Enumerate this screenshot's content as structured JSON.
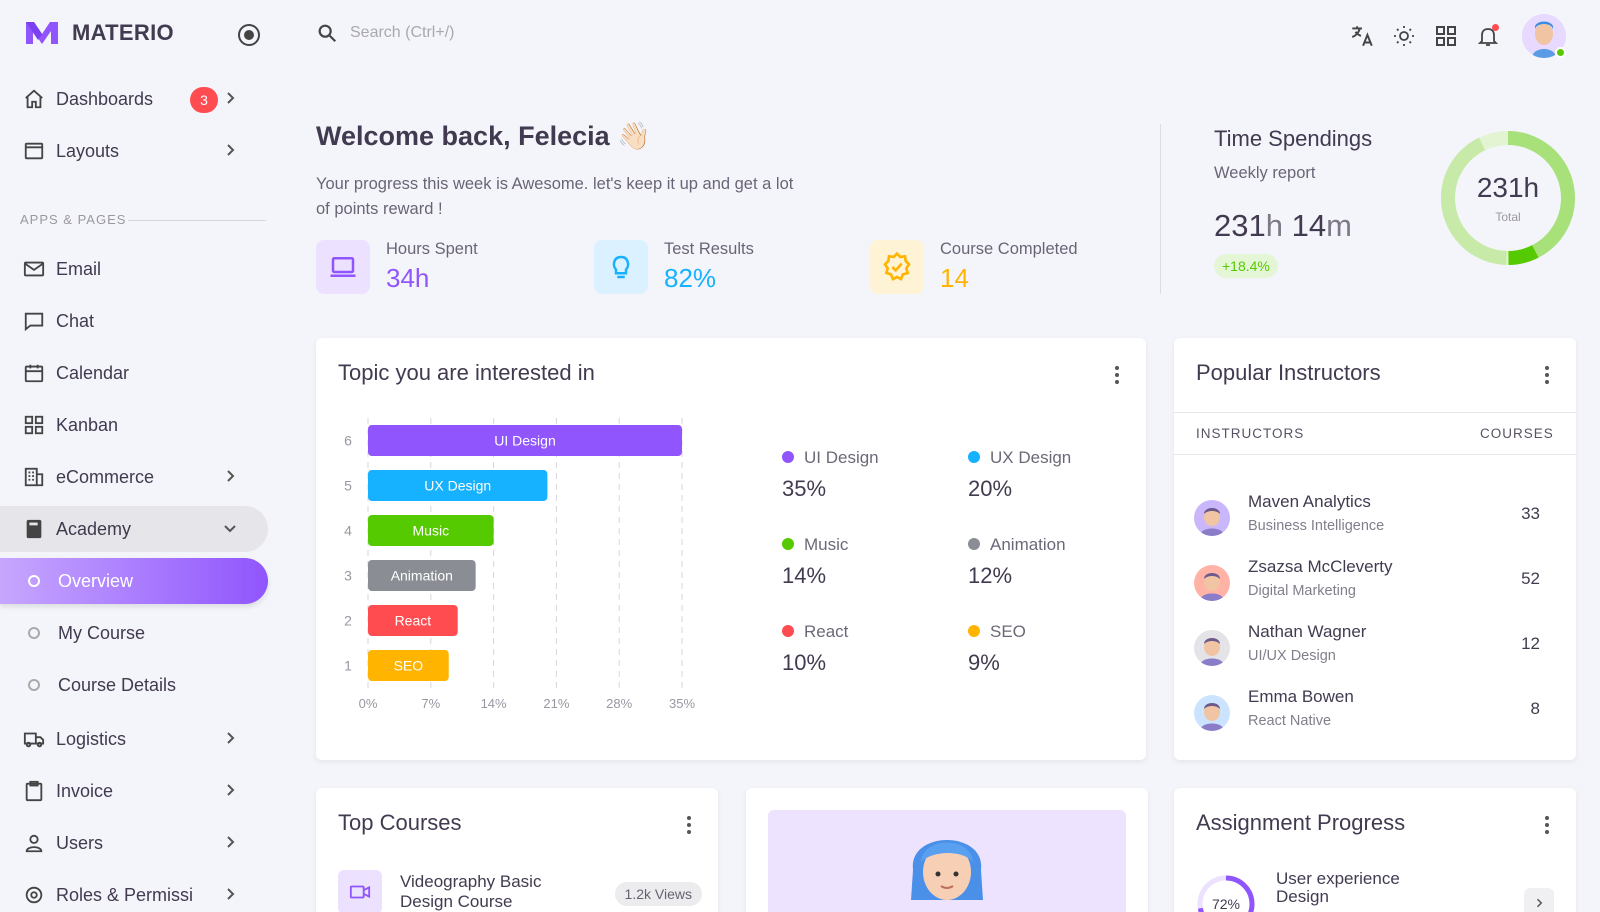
{
  "brand": {
    "name": "MATERIO"
  },
  "sidebar": {
    "items": [
      {
        "label": "Dashboards",
        "badge": "3"
      },
      {
        "label": "Layouts"
      },
      {
        "label": "Email"
      },
      {
        "label": "Chat"
      },
      {
        "label": "Calendar"
      },
      {
        "label": "Kanban"
      },
      {
        "label": "eCommerce"
      },
      {
        "label": "Academy"
      },
      {
        "label": "Overview"
      },
      {
        "label": "My Course"
      },
      {
        "label": "Course Details"
      },
      {
        "label": "Logistics"
      },
      {
        "label": "Invoice"
      },
      {
        "label": "Users"
      },
      {
        "label": "Roles & Permissi"
      }
    ],
    "section_header": "APPS & PAGES"
  },
  "search": {
    "placeholder": "Search (Ctrl+/)"
  },
  "welcome": {
    "title": "Welcome back, Felecia",
    "emoji": "👋🏻",
    "subtitle": "Your progress this week is Awesome. let's keep it up and get a lot of points reward !",
    "stats": [
      {
        "label": "Hours Spent",
        "value": "34h",
        "color": "#9055fd",
        "icon": "laptop-icon"
      },
      {
        "label": "Test Results",
        "value": "82%",
        "color": "#16b1ff",
        "icon": "lightbulb-icon"
      },
      {
        "label": "Course Completed",
        "value": "14",
        "color": "#ffb400",
        "icon": "badge-check-icon"
      }
    ]
  },
  "time_spendings": {
    "title": "Time Spendings",
    "subtitle": "Weekly report",
    "hours": "231",
    "hours_unit": "h",
    "minutes": "14",
    "minutes_unit": "m",
    "change": "+18.4%",
    "donut_value": "231h",
    "donut_label": "Total"
  },
  "topics": {
    "title": "Topic you are interested in",
    "legend": [
      {
        "name": "UI Design",
        "value": "35%",
        "color": "#9055fd"
      },
      {
        "name": "UX Design",
        "value": "20%",
        "color": "#16b1ff"
      },
      {
        "name": "Music",
        "value": "14%",
        "color": "#56ca00"
      },
      {
        "name": "Animation",
        "value": "12%",
        "color": "#8a8d93"
      },
      {
        "name": "React",
        "value": "10%",
        "color": "#ff4c51"
      },
      {
        "name": "SEO",
        "value": "9%",
        "color": "#ffb400"
      }
    ]
  },
  "chart_data": {
    "type": "bar",
    "orientation": "horizontal",
    "categories": [
      "UI Design",
      "UX Design",
      "Music",
      "Animation",
      "React",
      "SEO"
    ],
    "y_tick_labels": [
      "6",
      "5",
      "4",
      "3",
      "2",
      "1"
    ],
    "values": [
      35,
      20,
      14,
      12,
      10,
      9
    ],
    "colors": [
      "#9055fd",
      "#16b1ff",
      "#56ca00",
      "#8a8d93",
      "#ff4c51",
      "#ffb400"
    ],
    "x_ticks": [
      "0%",
      "7%",
      "14%",
      "21%",
      "28%",
      "35%"
    ],
    "xlim": [
      0,
      35
    ],
    "grid": "vertical dashed"
  },
  "instructors": {
    "title": "Popular Instructors",
    "col_instructors": "INSTRUCTORS",
    "col_courses": "COURSES",
    "rows": [
      {
        "name": "Maven Analytics",
        "role": "Business Intelligence",
        "courses": "33",
        "bg": "#c9b6fb"
      },
      {
        "name": "Zsazsa McCleverty",
        "role": "Digital Marketing",
        "courses": "52",
        "bg": "#ffb3a6"
      },
      {
        "name": "Nathan Wagner",
        "role": "UI/UX Design",
        "courses": "12",
        "bg": "#e4e4e8"
      },
      {
        "name": "Emma Bowen",
        "role": "React Native",
        "courses": "8",
        "bg": "#cbe3ff"
      }
    ]
  },
  "top_courses": {
    "title": "Top Courses",
    "first_course": "Videography Basic Design Course",
    "first_views": "1.2k Views"
  },
  "assignment": {
    "title": "Assignment Progress",
    "first_item": "User experience Design",
    "first_percent": "72%"
  }
}
